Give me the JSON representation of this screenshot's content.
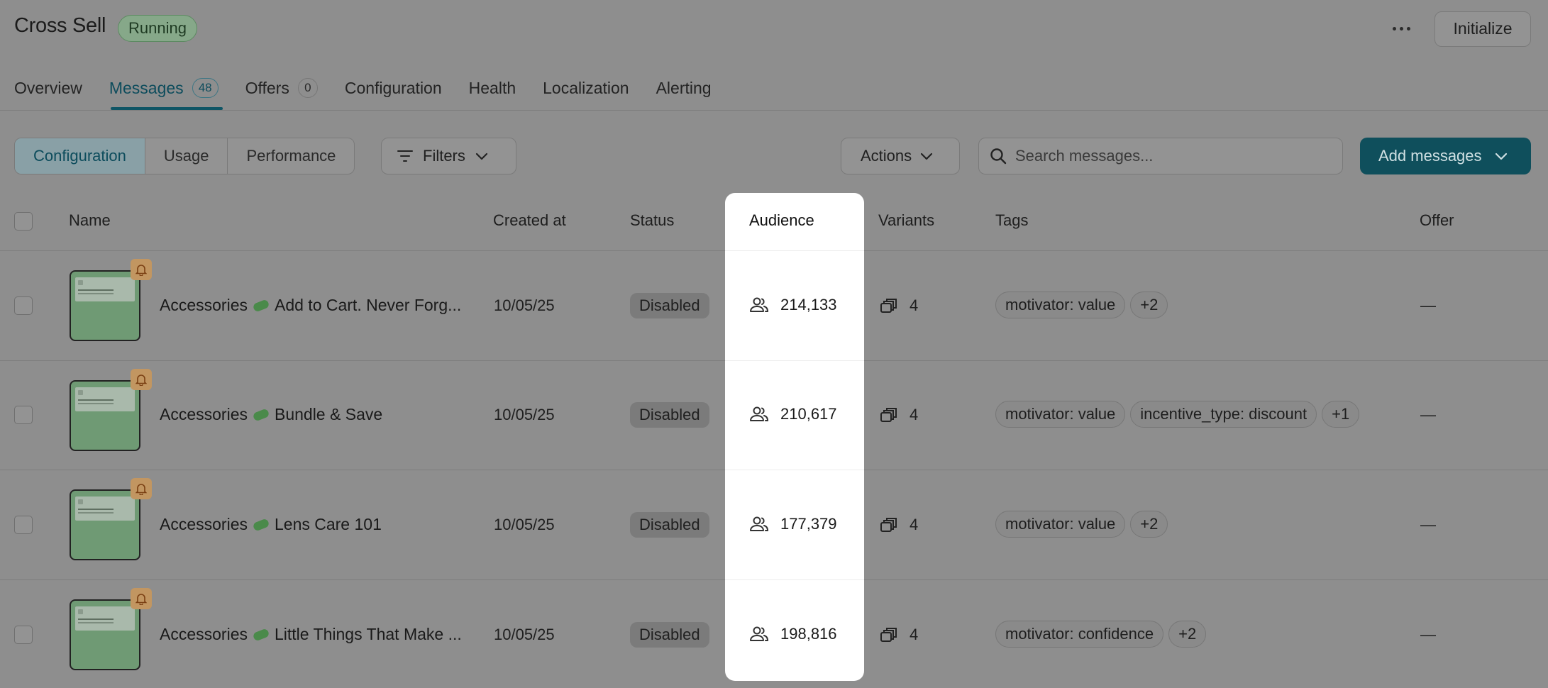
{
  "header": {
    "title": "Cross Sell",
    "status_badge": "Running",
    "initialize_label": "Initialize"
  },
  "tabs": [
    {
      "label": "Overview"
    },
    {
      "label": "Messages",
      "count": "48",
      "active": true
    },
    {
      "label": "Offers",
      "count": "0"
    },
    {
      "label": "Configuration"
    },
    {
      "label": "Health"
    },
    {
      "label": "Localization"
    },
    {
      "label": "Alerting"
    }
  ],
  "toolbar": {
    "views": [
      "Configuration",
      "Usage",
      "Performance"
    ],
    "active_view": "Configuration",
    "filters_label": "Filters",
    "actions_label": "Actions",
    "search_placeholder": "Search messages...",
    "add_label": "Add messages"
  },
  "table": {
    "columns": {
      "name": "Name",
      "created_at": "Created at",
      "status": "Status",
      "audience": "Audience",
      "variants": "Variants",
      "tags": "Tags",
      "offer": "Offer"
    },
    "rows": [
      {
        "name_prefix": "Accessories",
        "name_suffix": "Add to Cart. Never Forg...",
        "created_at": "10/05/25",
        "status": "Disabled",
        "audience": "214,133",
        "variants": "4",
        "tags": [
          "motivator: value",
          "+2"
        ],
        "offer": "—"
      },
      {
        "name_prefix": "Accessories",
        "name_suffix": "Bundle & Save",
        "created_at": "10/05/25",
        "status": "Disabled",
        "audience": "210,617",
        "variants": "4",
        "tags": [
          "motivator: value",
          "incentive_type: discount",
          "+1"
        ],
        "offer": "—"
      },
      {
        "name_prefix": "Accessories",
        "name_suffix": "Lens Care 101",
        "created_at": "10/05/25",
        "status": "Disabled",
        "audience": "177,379",
        "variants": "4",
        "tags": [
          "motivator: value",
          "+2"
        ],
        "offer": "—"
      },
      {
        "name_prefix": "Accessories",
        "name_suffix": "Little Things That Make ...",
        "created_at": "10/05/25",
        "status": "Disabled",
        "audience": "198,816",
        "variants": "4",
        "tags": [
          "motivator: confidence",
          "+2"
        ],
        "offer": "—"
      }
    ]
  },
  "colors": {
    "accent": "#0f4f5c",
    "overlay_bg": "#8e8e8e",
    "highlight": "#ffffff"
  }
}
